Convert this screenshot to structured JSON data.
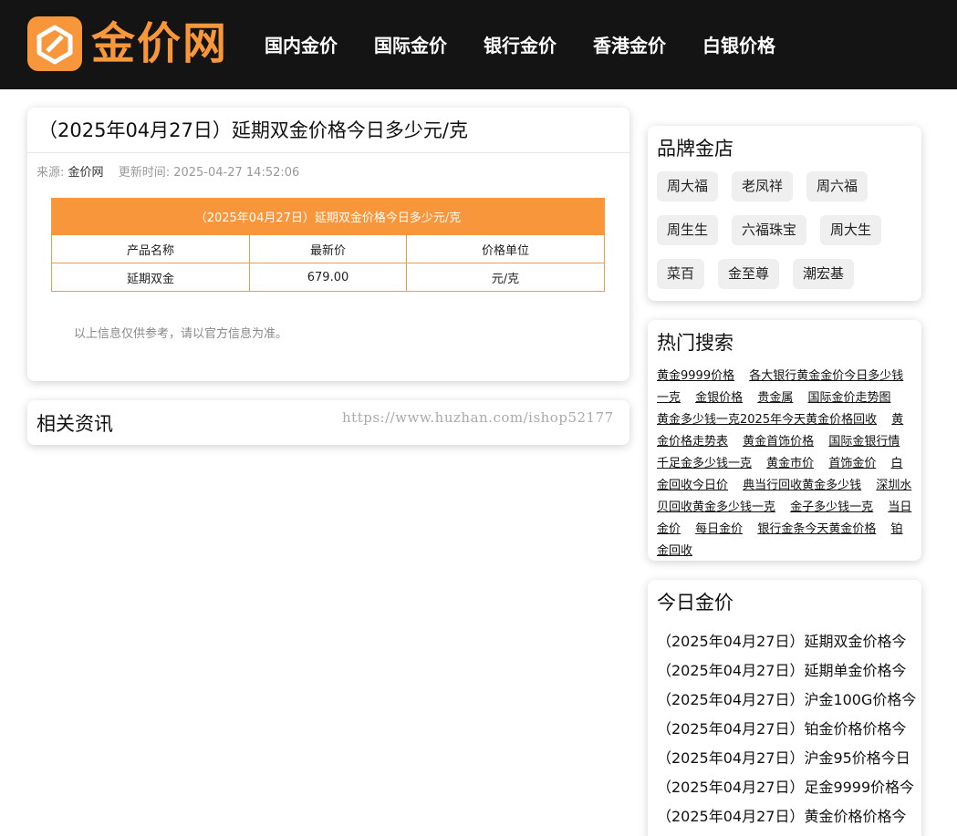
{
  "header": {
    "logo_text": "金价网",
    "nav": [
      "国内金价",
      "国际金价",
      "银行金价",
      "香港金价",
      "白银价格"
    ]
  },
  "article": {
    "title": "（2025年04月27日）延期双金价格今日多少元/克",
    "source_label": "来源:",
    "source_value": "金价网",
    "update_label": "更新时间:",
    "update_value": "2025-04-27 14:52:06",
    "table": {
      "caption": "（2025年04月27日）延期双金价格今日多少元/克",
      "headers": [
        "产品名称",
        "最新价",
        "价格单位"
      ],
      "row": [
        "延期双金",
        "679.00",
        "元/克"
      ]
    },
    "disclaimer": "以上信息仅供参考，请以官方信息为准。"
  },
  "related": {
    "title": "相关资讯",
    "watermark": "https://www.huzhan.com/ishop52177"
  },
  "sidebar": {
    "brands": {
      "title": "品牌金店",
      "rows": [
        [
          "周大福",
          "老凤祥",
          "周六福"
        ],
        [
          "周生生",
          "六福珠宝",
          "周大生"
        ],
        [
          "菜百",
          "金至尊",
          "潮宏基"
        ]
      ]
    },
    "hot": {
      "title": "热门搜索",
      "links": [
        "黄金9999价格",
        "各大银行黄金金价今日多少钱一克",
        "金银价格",
        "贵金属",
        "国际金价走势图",
        "黄金多少钱一克2025年今天黄金价格回收",
        "黄金价格走势表",
        "黄金首饰价格",
        "国际金银行情",
        "千足金多少钱一克",
        "黄金市价",
        "首饰金价",
        "白金回收今日价",
        "典当行回收黄金多少钱",
        "深圳水贝回收黄金多少钱一克",
        "金子多少钱一克",
        "当日金价",
        "每日金价",
        "银行金条今天黄金价格",
        "铂金回收"
      ]
    },
    "today": {
      "title": "今日金价",
      "items": [
        "（2025年04月27日）延期双金价格今",
        "（2025年04月27日）延期单金价格今",
        "（2025年04月27日）沪金100G价格今",
        "（2025年04月27日）铂金价格价格今",
        "（2025年04月27日）沪金95价格今日",
        "（2025年04月27日）足金9999价格今",
        "（2025年04月27日）黄金价格价格今"
      ]
    }
  },
  "colors": {
    "accent": "#f7963a",
    "header_bg": "#141414"
  }
}
